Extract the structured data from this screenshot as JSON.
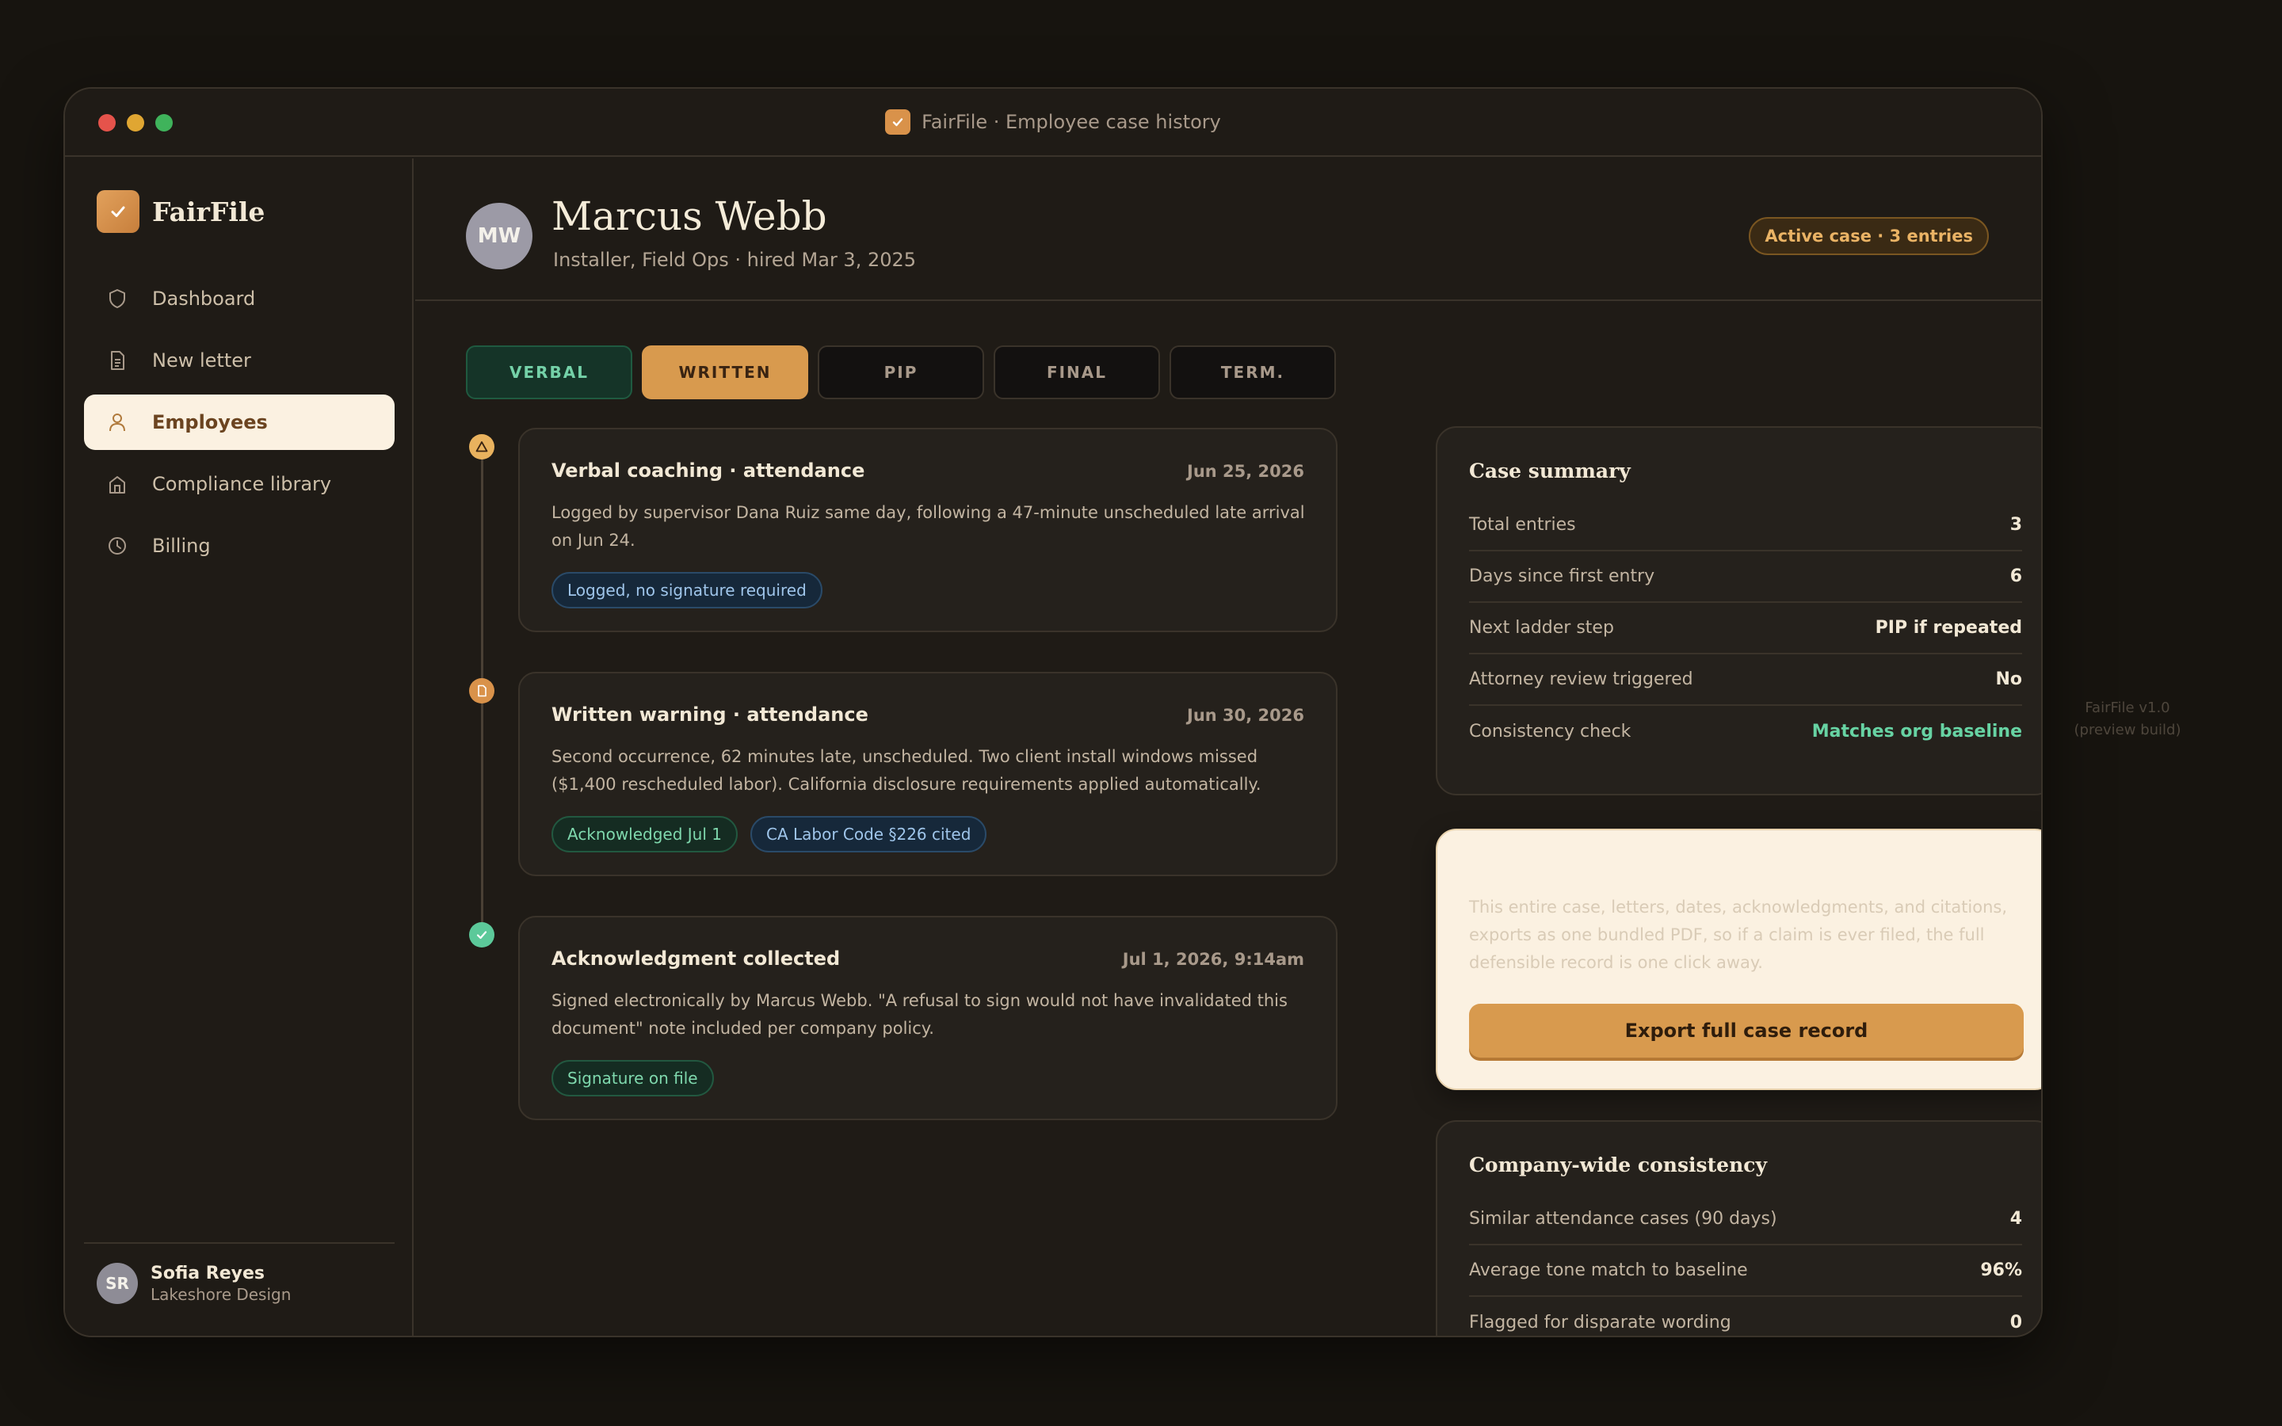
{
  "window": {
    "title": "FairFile · Employee case history"
  },
  "brand": {
    "name": "FairFile"
  },
  "sidebar": {
    "items": [
      {
        "label": "Dashboard",
        "icon": "shield-icon"
      },
      {
        "label": "New letter",
        "icon": "document-icon"
      },
      {
        "label": "Employees",
        "icon": "person-icon",
        "active": true
      },
      {
        "label": "Compliance library",
        "icon": "library-icon"
      },
      {
        "label": "Billing",
        "icon": "clock-icon"
      }
    ]
  },
  "user": {
    "initials": "SR",
    "name": "Sofia Reyes",
    "org": "Lakeshore Design"
  },
  "employee": {
    "initials": "MW",
    "name": "Marcus Webb",
    "role": "Installer, Field Ops · hired Mar 3, 2025",
    "badge": "Active case · 3 entries"
  },
  "ladder": {
    "steps": [
      {
        "label": "VERBAL",
        "state": "done"
      },
      {
        "label": "WRITTEN",
        "state": "current"
      },
      {
        "label": "PIP",
        "state": "upcoming"
      },
      {
        "label": "FINAL",
        "state": "upcoming"
      },
      {
        "label": "TERM.",
        "state": "upcoming"
      }
    ]
  },
  "timeline": [
    {
      "title": "Verbal coaching · attendance",
      "date": "Jun 25, 2026",
      "body": "Logged by supervisor Dana Ruiz same day, following a 47-minute unscheduled late arrival on Jun 24.",
      "tags": [
        {
          "label": "Logged, no signature required",
          "color": "blue"
        }
      ],
      "marker": "warning-icon",
      "marker_color": "#e9b25e"
    },
    {
      "title": "Written warning · attendance",
      "date": "Jun 30, 2026",
      "body": "Second occurrence, 62 minutes late, unscheduled. Two client install windows missed ($1,400 rescheduled labor). California disclosure requirements applied automatically.",
      "tags": [
        {
          "label": "Acknowledged Jul 1",
          "color": "green"
        },
        {
          "label": "CA Labor Code §226 cited",
          "color": "blue"
        }
      ],
      "marker": "document-icon",
      "marker_color": "#d9924a"
    },
    {
      "title": "Acknowledgment collected",
      "date": "Jul 1, 2026, 9:14am",
      "body": "Signed electronically by Marcus Webb. \"A refusal to sign would not have invalidated this document\" note included per company policy.",
      "tags": [
        {
          "label": "Signature on file",
          "color": "green"
        }
      ],
      "marker": "check-icon",
      "marker_color": "#5cc99a"
    }
  ],
  "case_summary": {
    "title": "Case summary",
    "rows": [
      {
        "label": "Total entries",
        "value": "3"
      },
      {
        "label": "Days since first entry",
        "value": "6"
      },
      {
        "label": "Next ladder step",
        "value": "PIP if repeated"
      },
      {
        "label": "Attorney review triggered",
        "value": "No"
      },
      {
        "label": "Consistency check",
        "value": "Matches org baseline",
        "status": "ok"
      }
    ]
  },
  "export": {
    "body": "This entire case, letters, dates, acknowledgments, and citations, exports as one bundled PDF, so if a claim is ever filed, the full defensible record is one click away.",
    "button": "Export full case record"
  },
  "consistency": {
    "title": "Company-wide consistency",
    "rows": [
      {
        "label": "Similar attendance cases (90 days)",
        "value": "4"
      },
      {
        "label": "Average tone match to baseline",
        "value": "96%"
      },
      {
        "label": "Flagged for disparate wording",
        "value": "0"
      }
    ]
  },
  "footnote": "FairFile v1.0 (preview build)",
  "colors": {
    "accent": "#d89a4e",
    "background": "#17140f",
    "success": "#67d3a3"
  }
}
